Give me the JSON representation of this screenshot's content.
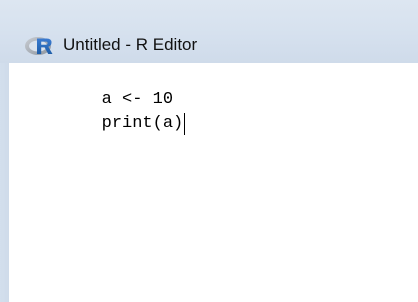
{
  "window": {
    "title": "Untitled - R Editor",
    "app_icon": "r-logo-icon",
    "accent_color": "#1f67b5",
    "titlebar_color": "#d7e2ef"
  },
  "editor": {
    "lines": [
      "a <- 10",
      "print(a)"
    ],
    "cursor": {
      "line": 2,
      "column": 9
    }
  }
}
